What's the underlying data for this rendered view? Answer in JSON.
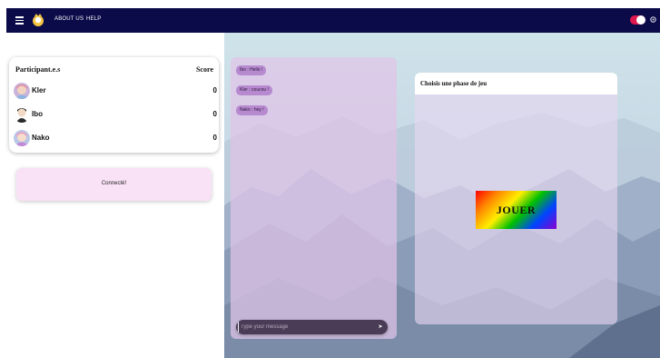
{
  "nav": {
    "about": "ABOUT US",
    "help": "HELP"
  },
  "icons": {
    "menu": "hamburger-menu-icon",
    "logo": "app-logo-icon",
    "settings": "gear-icon",
    "send": "send-arrow-icon"
  },
  "theme": {
    "navbar": "#0b0b4a",
    "toggle_on": "#e0174f",
    "status_bg": "#f9e2f6",
    "chat_bubble": "#b78ad0",
    "chat_input_bg": "#4a3c56"
  },
  "scoreboard": {
    "header_name": "Participant.e.s",
    "header_score": "Score",
    "players": [
      {
        "name": "Kler",
        "score": "0"
      },
      {
        "name": "Ibo",
        "score": "0"
      },
      {
        "name": "Nako",
        "score": "0"
      }
    ]
  },
  "status": {
    "text": "Connecté!"
  },
  "chat": {
    "messages": [
      "Ibo : Hello !",
      "Kler : coucou !",
      "Nako : hey !"
    ],
    "placeholder": "Type your message",
    "send_label": "➤"
  },
  "phase": {
    "title": "Choisis une phase de jeu",
    "play_label": "JOUER"
  }
}
